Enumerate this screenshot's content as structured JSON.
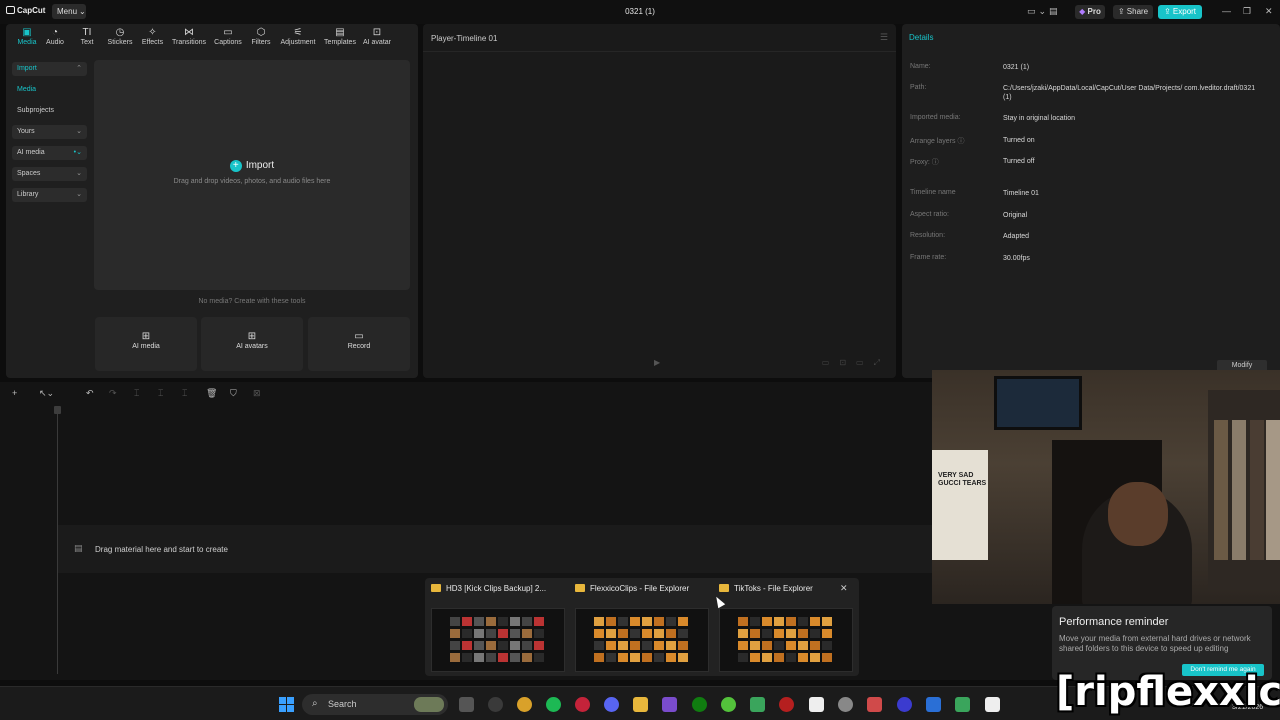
{
  "app": {
    "logo": "CapCut",
    "menu_label": "Menu",
    "project_title": "0321 (1)",
    "pro_label": "Pro",
    "share_label": "Share",
    "export_label": "Export"
  },
  "toolbar": {
    "tabs": [
      "Media",
      "Audio",
      "Text",
      "Stickers",
      "Effects",
      "Transitions",
      "Captions",
      "Filters",
      "Adjustment",
      "Templates",
      "AI avatar"
    ],
    "active": "Media"
  },
  "sidebar": {
    "items": [
      "Import",
      "Media",
      "Subprojects",
      "Yours",
      "AI media",
      "Spaces",
      "Library"
    ]
  },
  "import_zone": {
    "button": "Import",
    "hint": "Drag and drop videos, photos, and audio files here"
  },
  "tools": {
    "caption": "No media? Create with these tools",
    "cards": [
      "AI media",
      "AI avatars",
      "Record"
    ]
  },
  "player": {
    "title": "Player-Timeline 01"
  },
  "details": {
    "title": "Details",
    "rows": [
      {
        "label": "Name:",
        "value": "0321 (1)"
      },
      {
        "label": "Path:",
        "value": "C:/Users/jzaki/AppData/Local/CapCut/User Data/Projects/ com.lveditor.draft/0321 (1)"
      },
      {
        "label": "Imported media:",
        "value": "Stay in original location"
      },
      {
        "label": "Arrange layers ⓘ",
        "value": "Turned on"
      },
      {
        "label": "Proxy: ⓘ",
        "value": "Turned off"
      },
      {
        "label": "Timeline name",
        "value": "Timeline 01"
      },
      {
        "label": "Aspect ratio:",
        "value": "Original"
      },
      {
        "label": "Resolution:",
        "value": "Adapted"
      },
      {
        "label": "Frame rate:",
        "value": "30.00fps"
      }
    ],
    "modify_label": "Modify"
  },
  "timeline": {
    "drag_text": "Drag material here and start to create"
  },
  "webcam": {
    "shirt_text": "VERY SAD GUCCI TEARS"
  },
  "explorer_thumbs": [
    {
      "title": "HD3 [Kick Clips Backup] 2..."
    },
    {
      "title": "FlexxicoClips - File Explorer"
    },
    {
      "title": "TikToks - File Explorer"
    }
  ],
  "perf_reminder": {
    "title": "Performance reminder",
    "text": "Move your media from external hard drives or network shared folders to this device to speed up editing",
    "button": "Don't remind me again"
  },
  "taskbar": {
    "search_placeholder": "Search",
    "date": "3/21/2026"
  },
  "watermark": "[ripflexxico]",
  "colors": {
    "accent": "#18c4c9",
    "panel": "#1f1f1f",
    "bg": "#0d0d0d"
  }
}
